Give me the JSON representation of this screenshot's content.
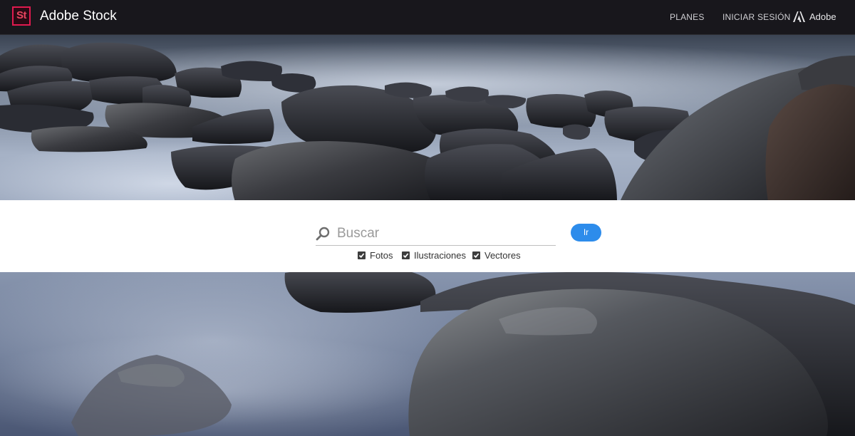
{
  "header": {
    "logo_text": "St",
    "brand": "Adobe Stock",
    "nav": {
      "plans": "PLANES",
      "login": "INICIAR SESIÓN",
      "adobe": "Adobe"
    }
  },
  "search": {
    "placeholder": "Buscar",
    "value": "",
    "go_label": "Ir",
    "filters": [
      {
        "label": "Fotos",
        "checked": true
      },
      {
        "label": "Ilustraciones",
        "checked": true
      },
      {
        "label": "Vectores",
        "checked": true
      }
    ]
  },
  "hero": {
    "subject": "misty long-exposure sea with dark rocks"
  },
  "colors": {
    "topbar": "#18171c",
    "logo_accent": "#e01a4f",
    "go_button": "#2d8ceb",
    "mist": "#9aa8bf"
  }
}
